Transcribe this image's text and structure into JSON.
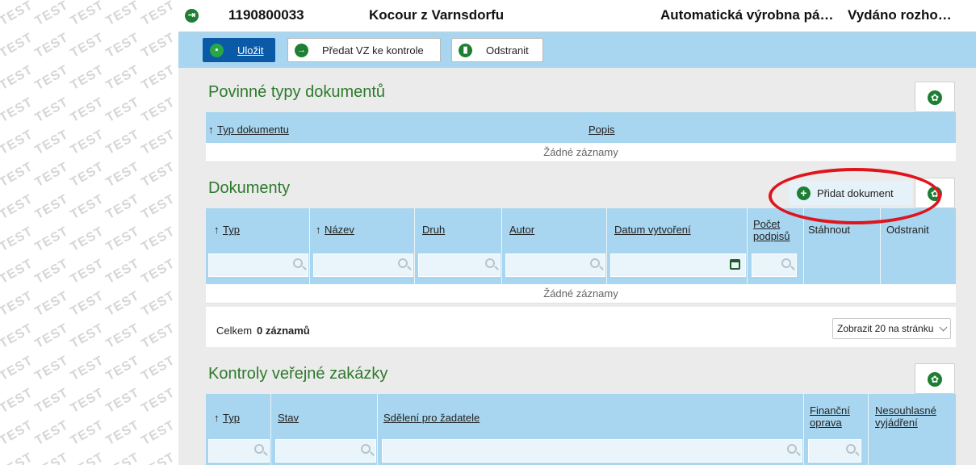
{
  "watermark": {
    "text": "TEST"
  },
  "titlebar": {
    "id": "1190800033",
    "name": "Kocour z Varnsdorfu",
    "project": "Automatická výrobna pá…",
    "status": "Vydáno rozho…"
  },
  "toolbar": {
    "save_label": "Uložit",
    "submit_label": "Předat VZ ke kontrole",
    "delete_label": "Odstranit"
  },
  "required_docs": {
    "title": "Povinné typy dokumentů",
    "columns": [
      {
        "label": "Typ dokumentu",
        "sort": "↑"
      },
      {
        "label": "Popis"
      }
    ],
    "empty_text": "Žádné záznamy"
  },
  "documents": {
    "title": "Dokumenty",
    "add_label": "Přidat dokument",
    "columns": [
      {
        "label": "Typ",
        "sort": "↑"
      },
      {
        "label": "Název",
        "sort": "↑"
      },
      {
        "label": "Druh"
      },
      {
        "label": "Autor"
      },
      {
        "label": "Datum vytvoření"
      },
      {
        "label": "Počet podpisů"
      },
      {
        "label": "Stáhnout"
      },
      {
        "label": "Odstranit"
      }
    ],
    "empty_text": "Žádné záznamy",
    "total_prefix": "Celkem",
    "total_count": "0 záznamů",
    "page_size_label": "Zobrazit 20 na stránku"
  },
  "controls": {
    "title": "Kontroly veřejné zakázky",
    "columns": [
      {
        "label": "Typ",
        "sort": "↑"
      },
      {
        "label": "Stav"
      },
      {
        "label": "Sdělení pro žadatele"
      },
      {
        "label": "Finanční oprava"
      },
      {
        "label": "Nesouhlasné vyjádření"
      }
    ]
  },
  "colors": {
    "accent_green": "#1e7e34",
    "header_blue": "#a8d5ef",
    "primary_button": "#0b5aa8",
    "highlight_ring": "#e0141b"
  }
}
